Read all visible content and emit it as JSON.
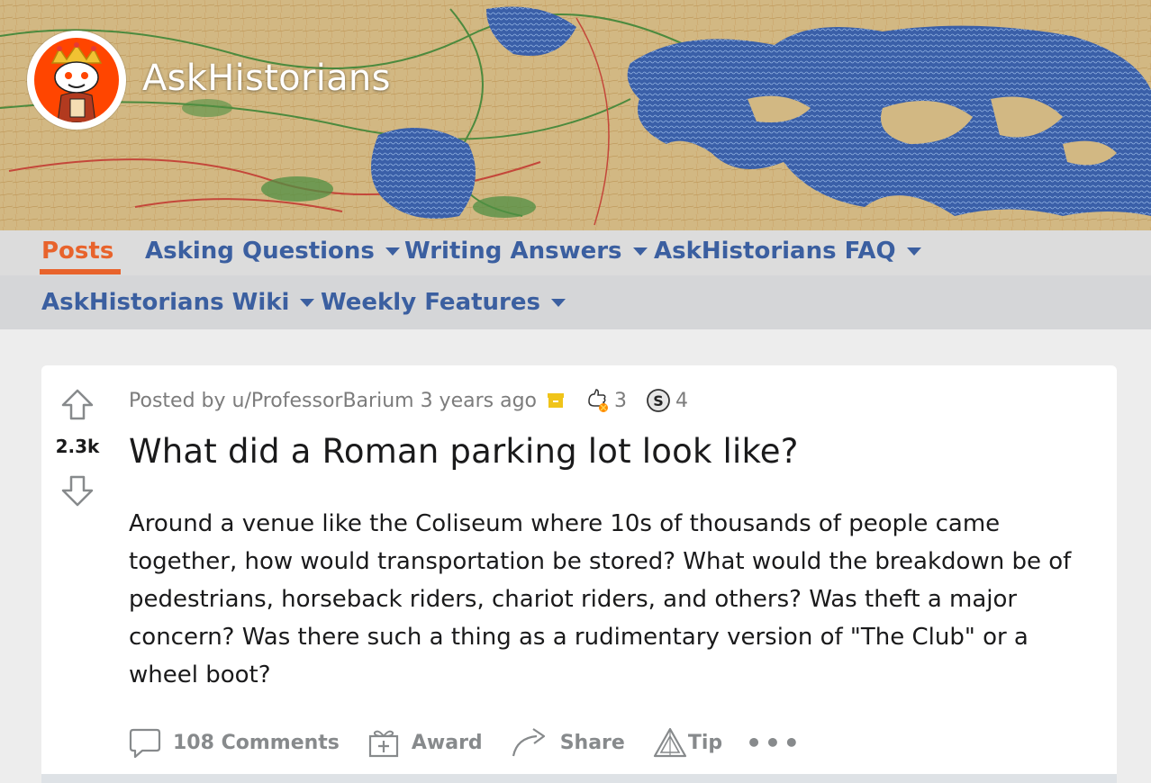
{
  "subreddit": {
    "name": "AskHistorians",
    "brand_color": "#ff4500",
    "icon": "snoo-king-avatar-icon"
  },
  "nav": {
    "row1": [
      {
        "label": "Posts",
        "active": true
      },
      {
        "label": "Asking Questions",
        "dropdown": true
      },
      {
        "label": "Writing Answers",
        "dropdown": true
      },
      {
        "label": "AskHistorians FAQ",
        "dropdown": true
      }
    ],
    "row2": [
      {
        "label": "AskHistorians Wiki",
        "dropdown": true
      },
      {
        "label": "Weekly Features",
        "dropdown": true
      }
    ],
    "active_color": "#e8632c",
    "link_color": "#3b5fa0"
  },
  "post": {
    "meta_prefix": "Posted by u/ProfessorBarium 3 years ago",
    "award1_count": "3",
    "award2_count": "4",
    "vote_count": "2.3k",
    "title": "What did a Roman parking lot look like?",
    "body": "Around a venue like the Coliseum where 10s of thousands of people came together, how would transportation be stored? What would the breakdown be of pedestrians, horseback riders, chariot riders, and others? Was theft a major concern? Was there such a thing as a rudimentary version of \"The Club\" or a wheel boot?"
  },
  "actions": {
    "comments": "108 Comments",
    "award": "Award",
    "share": "Share",
    "tip": "Tip",
    "more": "•••"
  }
}
